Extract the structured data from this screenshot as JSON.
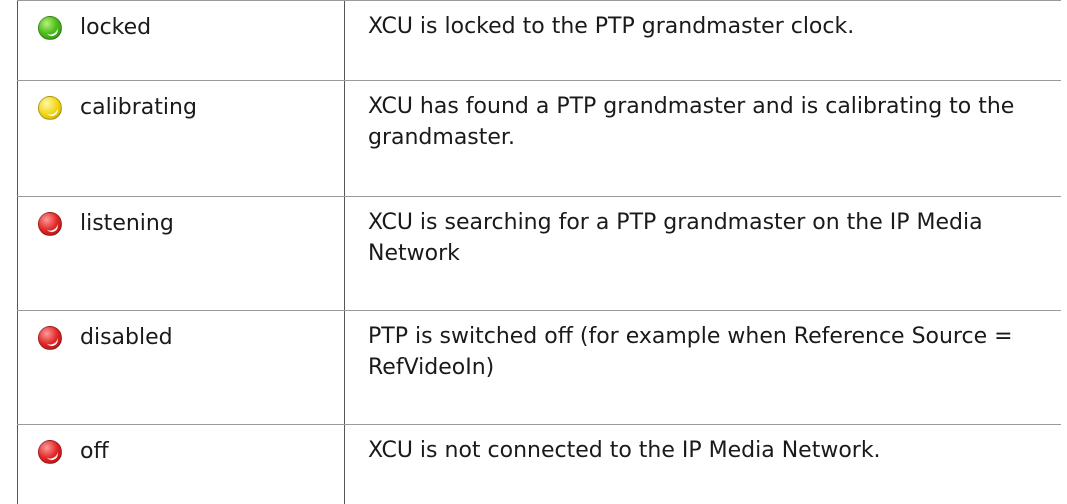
{
  "status_table": {
    "rows": [
      {
        "status": "locked",
        "indicator": "green-led-icon",
        "color": "#4fbf1f",
        "description": "XCU is locked to the PTP grandmaster clock."
      },
      {
        "status": "calibrating",
        "indicator": "yellow-led-icon",
        "color": "#f2d616",
        "description": "XCU has found a PTP grandmaster and is calibrating to the grandmaster."
      },
      {
        "status": "listening",
        "indicator": "red-led-icon",
        "color": "#e02626",
        "description": "XCU is searching for a PTP grandmaster on the IP Media Network"
      },
      {
        "status": "disabled",
        "indicator": "red-led-icon",
        "color": "#e02626",
        "description": "PTP is switched off (for example when Reference Source = RefVideoIn)"
      },
      {
        "status": "off",
        "indicator": "red-led-icon",
        "color": "#e02626",
        "description": "XCU is not connected to the IP Media Network."
      }
    ]
  }
}
